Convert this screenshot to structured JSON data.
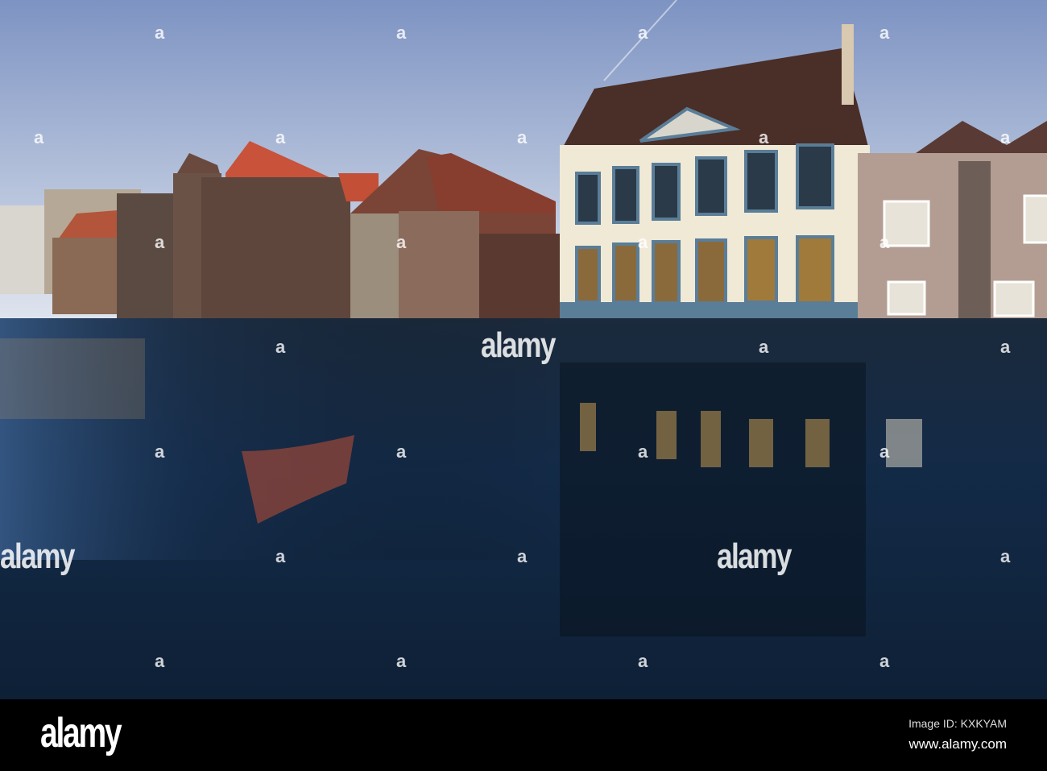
{
  "watermark": {
    "text": "alamy",
    "mark": "a"
  },
  "footer": {
    "logo": "alamy",
    "image_id": "Image ID: KXKYAM",
    "url": "www.alamy.com"
  },
  "colors": {
    "sky_top": "#7d93c2",
    "sky_bottom": "#dfe6f0",
    "water": "#0e2238",
    "facade_blue": "#5a7d98",
    "facade_cream": "#efe9d6",
    "brick": "#6a4a3e",
    "roof_red": "#c8523a"
  }
}
